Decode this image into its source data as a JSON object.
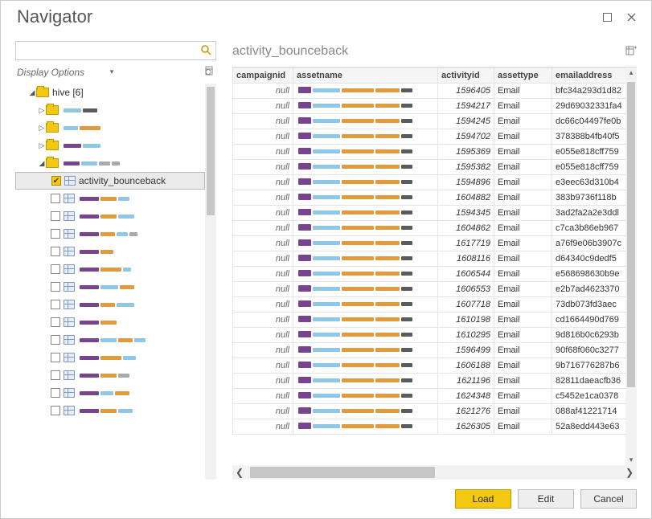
{
  "window": {
    "title": "Navigator"
  },
  "nav": {
    "display_options_label": "Display Options",
    "root_label": "hive [6]",
    "selected_item": "activity_bounceback"
  },
  "preview": {
    "title": "activity_bounceback",
    "columns": {
      "campaignid": "campaignid",
      "assetname": "assetname",
      "activityid": "activityid",
      "assettype": "assettype",
      "emailaddress": "emailaddress"
    },
    "rows": [
      {
        "campaignid": "null",
        "activityid": "1596405",
        "assettype": "Email",
        "emailaddress": "bfc34a293d1d82"
      },
      {
        "campaignid": "null",
        "activityid": "1594217",
        "assettype": "Email",
        "emailaddress": "29d69032331fa4"
      },
      {
        "campaignid": "null",
        "activityid": "1594245",
        "assettype": "Email",
        "emailaddress": "dc66c04497fe0b"
      },
      {
        "campaignid": "null",
        "activityid": "1594702",
        "assettype": "Email",
        "emailaddress": "378388b4fb40f5"
      },
      {
        "campaignid": "null",
        "activityid": "1595369",
        "assettype": "Email",
        "emailaddress": "e055e818cff759"
      },
      {
        "campaignid": "null",
        "activityid": "1595382",
        "assettype": "Email",
        "emailaddress": "e055e818cff759"
      },
      {
        "campaignid": "null",
        "activityid": "1594896",
        "assettype": "Email",
        "emailaddress": "e3eec63d310b4"
      },
      {
        "campaignid": "null",
        "activityid": "1604882",
        "assettype": "Email",
        "emailaddress": "383b9736f118b"
      },
      {
        "campaignid": "null",
        "activityid": "1594345",
        "assettype": "Email",
        "emailaddress": "3ad2fa2a2e3ddl"
      },
      {
        "campaignid": "null",
        "activityid": "1604862",
        "assettype": "Email",
        "emailaddress": "c7ca3b86eb967"
      },
      {
        "campaignid": "null",
        "activityid": "1617719",
        "assettype": "Email",
        "emailaddress": "a76f9e06b3907c"
      },
      {
        "campaignid": "null",
        "activityid": "1608116",
        "assettype": "Email",
        "emailaddress": "d64340c9dedf5"
      },
      {
        "campaignid": "null",
        "activityid": "1606544",
        "assettype": "Email",
        "emailaddress": "e568698630b9e"
      },
      {
        "campaignid": "null",
        "activityid": "1606553",
        "assettype": "Email",
        "emailaddress": "e2b7ad4623370"
      },
      {
        "campaignid": "null",
        "activityid": "1607718",
        "assettype": "Email",
        "emailaddress": "73db073fd3aec"
      },
      {
        "campaignid": "null",
        "activityid": "1610198",
        "assettype": "Email",
        "emailaddress": "cd1664490d769"
      },
      {
        "campaignid": "null",
        "activityid": "1610295",
        "assettype": "Email",
        "emailaddress": "9d816b0c6293b"
      },
      {
        "campaignid": "null",
        "activityid": "1596499",
        "assettype": "Email",
        "emailaddress": "90f68f060c3277"
      },
      {
        "campaignid": "null",
        "activityid": "1606188",
        "assettype": "Email",
        "emailaddress": "9b716776287b6"
      },
      {
        "campaignid": "null",
        "activityid": "1621196",
        "assettype": "Email",
        "emailaddress": "82811daeacfb36"
      },
      {
        "campaignid": "null",
        "activityid": "1624348",
        "assettype": "Email",
        "emailaddress": "c5452e1ca0378"
      },
      {
        "campaignid": "null",
        "activityid": "1621276",
        "assettype": "Email",
        "emailaddress": "088af41221714"
      },
      {
        "campaignid": "null",
        "activityid": "1626305",
        "assettype": "Email",
        "emailaddress": "52a8edd443e63"
      }
    ]
  },
  "footer": {
    "load": "Load",
    "edit": "Edit",
    "cancel": "Cancel"
  }
}
